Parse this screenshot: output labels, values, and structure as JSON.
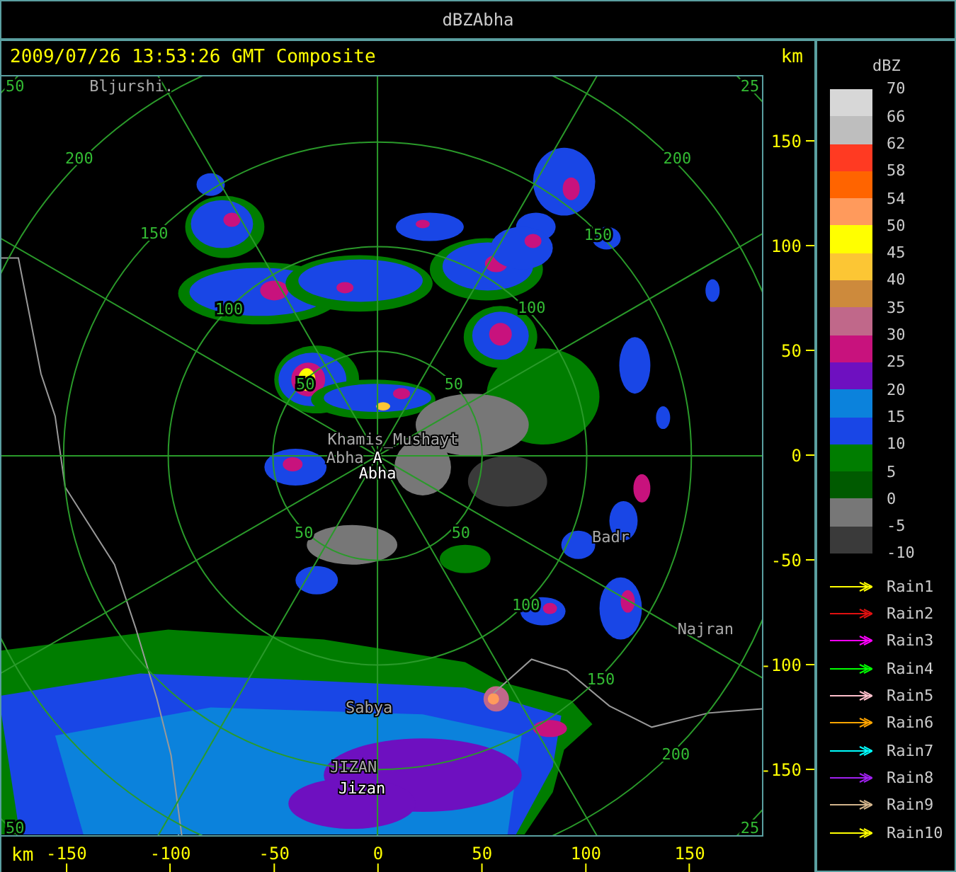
{
  "window": {
    "title": "dBZAbha"
  },
  "header": {
    "timestamp": "2009/07/26 13:53:26 GMT Composite",
    "unit": "km"
  },
  "map": {
    "ring_labels": [
      {
        "text": "50"
      },
      {
        "text": "25"
      },
      {
        "text": "200"
      },
      {
        "text": "200"
      },
      {
        "text": "150"
      },
      {
        "text": "150"
      },
      {
        "text": "100"
      },
      {
        "text": "100"
      },
      {
        "text": "50"
      },
      {
        "text": "50"
      },
      {
        "text": "50"
      },
      {
        "text": "50"
      },
      {
        "text": "100"
      },
      {
        "text": "150"
      },
      {
        "text": "200"
      },
      {
        "text": "50"
      },
      {
        "text": "25"
      }
    ],
    "places": [
      {
        "text": "Bljurshi.",
        "kind": "place"
      },
      {
        "text": "Khamis_Mushayt",
        "kind": "place"
      },
      {
        "text": "Abha",
        "kind": "place"
      },
      {
        "text": "A",
        "kind": "site"
      },
      {
        "text": "Abha",
        "kind": "site"
      },
      {
        "text": "Badr",
        "kind": "place"
      },
      {
        "text": "Najran",
        "kind": "place"
      },
      {
        "text": "Sabya",
        "kind": "place"
      },
      {
        "text": "JIZAN",
        "kind": "place"
      },
      {
        "text": "Jizan",
        "kind": "site"
      }
    ]
  },
  "y_axis": {
    "ticks": [
      "150",
      "100",
      "50",
      "0",
      "-50",
      "-100",
      "-150"
    ]
  },
  "x_axis": {
    "unit": "km",
    "ticks": [
      "-150",
      "-100",
      "-50",
      "0",
      "50",
      "100",
      "150"
    ]
  },
  "legend": {
    "title": "dBZ",
    "bands": [
      {
        "color": "#d7d7d7"
      },
      {
        "color": "#bebebe"
      },
      {
        "color": "#ff3a22"
      },
      {
        "color": "#ff6400"
      },
      {
        "color": "#ff9a5c"
      },
      {
        "color": "#ffff00"
      },
      {
        "color": "#fcc634"
      },
      {
        "color": "#cd8a3c"
      },
      {
        "color": "#c0688a"
      },
      {
        "color": "#c8127d"
      },
      {
        "color": "#6e10c0"
      },
      {
        "color": "#0b82dc"
      },
      {
        "color": "#1946e6"
      },
      {
        "color": "#007d00"
      },
      {
        "color": "#005a00"
      },
      {
        "color": "#777777"
      },
      {
        "color": "#3a3a3a"
      }
    ],
    "values": [
      "70",
      "66",
      "62",
      "58",
      "54",
      "50",
      "45",
      "40",
      "35",
      "30",
      "25",
      "20",
      "15",
      "10",
      "5",
      "0",
      "-5",
      "-10"
    ],
    "rain": [
      {
        "label": "Rain1",
        "color": "#ffff00"
      },
      {
        "label": "Rain2",
        "color": "#e01010"
      },
      {
        "label": "Rain3",
        "color": "#ff00ff"
      },
      {
        "label": "Rain4",
        "color": "#00ff00"
      },
      {
        "label": "Rain5",
        "color": "#ffc0cb"
      },
      {
        "label": "Rain6",
        "color": "#ffa500"
      },
      {
        "label": "Rain7",
        "color": "#00ffff"
      },
      {
        "label": "Rain8",
        "color": "#a020f0"
      },
      {
        "label": "Rain9",
        "color": "#d2b48c"
      },
      {
        "label": "Rain10",
        "color": "#ffff00"
      }
    ]
  }
}
